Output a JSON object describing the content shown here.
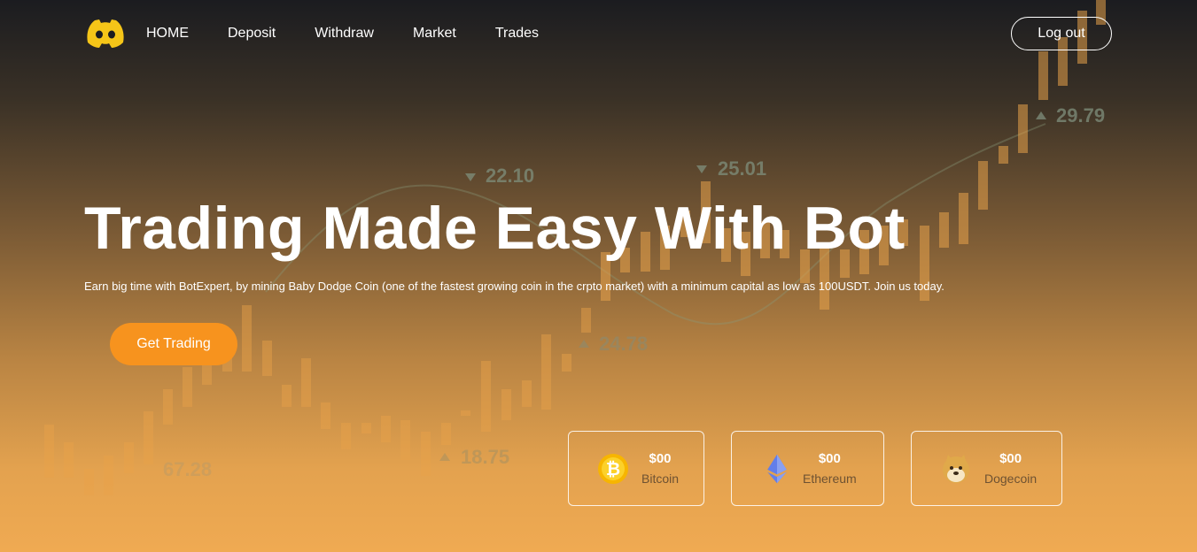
{
  "nav": {
    "links": [
      "HOME",
      "Deposit",
      "Withdraw",
      "Market",
      "Trades"
    ],
    "logout_label": "Log out"
  },
  "hero": {
    "title": "Trading Made Easy With Bot",
    "subtitle": "Earn big time with BotExpert, by mining Baby Dodge Coin (one of the fastest growing coin in the crpto market) with a minimum capital as low as 100USDT. Join us today.",
    "cta_label": "Get Trading"
  },
  "coins": [
    {
      "price": "$00",
      "name": "Bitcoin",
      "icon": "bitcoin-icon",
      "color": "#f7b500"
    },
    {
      "price": "$00",
      "name": "Ethereum",
      "icon": "ethereum-icon",
      "color": "#627eea"
    },
    {
      "price": "$00",
      "name": "Dogecoin",
      "icon": "dogecoin-icon",
      "color": "#d9a441"
    }
  ],
  "background_labels": [
    "22.10",
    "25.01",
    "29.79",
    "24.78",
    "18.75",
    "67.28"
  ],
  "colors": {
    "accent": "#f7931e",
    "candle": "#e8a24a"
  }
}
